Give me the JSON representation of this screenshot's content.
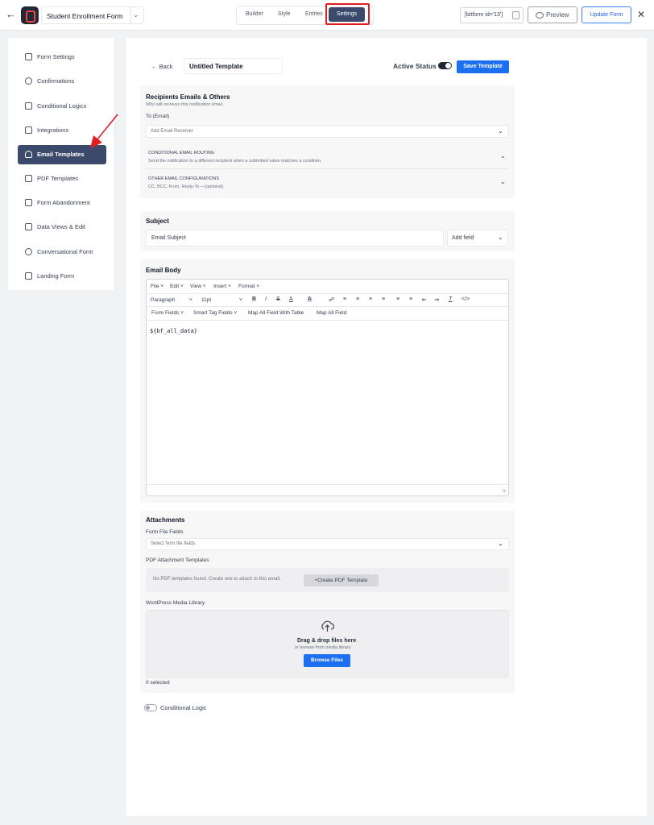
{
  "topbar": {
    "form_name": "Student Enrollment Form",
    "tabs": [
      "Builder",
      "Style",
      "Entries"
    ],
    "active_tab": "Settings",
    "shortcode": "[bitform id='13']",
    "preview_label": "Preview",
    "update_label": "Update Form"
  },
  "sidebar": {
    "items": [
      {
        "label": "Form Settings",
        "icon": "sliders-icon"
      },
      {
        "label": "Confirmations",
        "icon": "info-circle-icon"
      },
      {
        "label": "Conditional Logics",
        "icon": "branch-icon"
      },
      {
        "label": "Integrations",
        "icon": "code-icon"
      },
      {
        "label": "Email Templates",
        "icon": "envelope-open-icon",
        "active": true
      },
      {
        "label": "PDF Templates",
        "icon": "file-icon"
      },
      {
        "label": "Form Abandonment",
        "icon": "form-icon"
      },
      {
        "label": "Data Views & Edit",
        "icon": "table-icon"
      },
      {
        "label": "Conversational Form",
        "icon": "chat-icon"
      },
      {
        "label": "Landing Form",
        "icon": "page-icon"
      }
    ]
  },
  "template": {
    "back_label": "Back",
    "name": "Untitled Template",
    "active_status_label": "Active Status",
    "save_label": "Save Template"
  },
  "recipients": {
    "title": "Recipients Emails & Others",
    "subtitle": "Who will receives this notification email.",
    "to_label": "To (Email)",
    "to_placeholder": "Add Email Receiver",
    "routing_title": "CONDITIONAL EMAIL ROUTING",
    "routing_desc": "Send the notification to a different recipient when a submitted value matches a condition.",
    "other_title": "OTHER EMAIL CONFIGURATIONS",
    "other_desc": "CC, BCC, From, Reply-To —(optional)."
  },
  "subject": {
    "title": "Subject",
    "value": "Email Subject",
    "add_field_label": "Add field"
  },
  "body": {
    "title": "Email Body",
    "menus": [
      "File",
      "Edit",
      "View",
      "Insert",
      "Format"
    ],
    "block_format": "Paragraph",
    "font_size": "11pt",
    "field_menus": [
      "Form Fields",
      "Smart Tag Fields",
      "Map All Field With Table",
      "Map All Field"
    ],
    "content": "${bf_all_data}"
  },
  "attachments": {
    "title": "Attachments",
    "file_fields_label": "Form File Fields",
    "file_fields_placeholder": "Select form file fields",
    "pdf_label": "PDF Attachment Templates",
    "pdf_empty_text": "No PDF templates found. Create one to attach to this email.",
    "create_pdf_label": "+Create PDF Template",
    "media_label": "WordPress Media Library",
    "drop_title": "Drag & drop files here",
    "drop_sub": "or browse from media library",
    "browse_label": "Browse Files",
    "selected_text": "0 selected"
  },
  "conditional_logic_label": "Conditional Logic",
  "colors": {
    "accent": "#1d6ff2",
    "nav_active": "#3b4a6b",
    "highlight": "#e11d24"
  }
}
